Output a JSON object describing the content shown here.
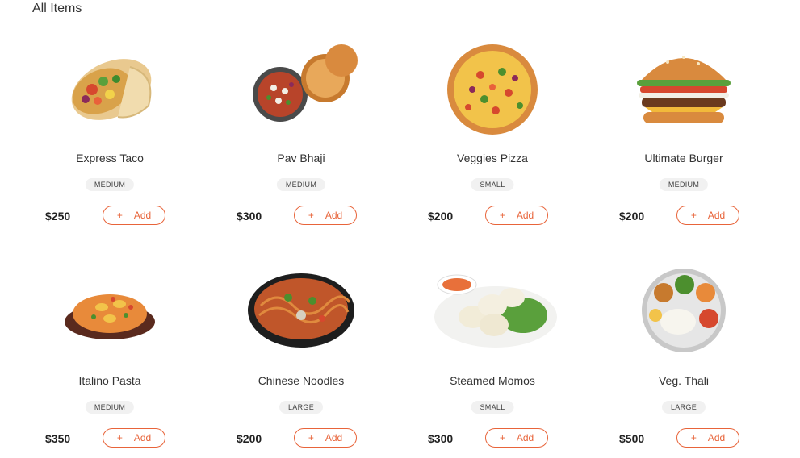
{
  "section_title": "All Items",
  "accent_color": "#e8643a",
  "items": [
    {
      "name": "Express Taco",
      "size": "MEDIUM",
      "price": "$250",
      "add_label": "Add",
      "add_icon": "+",
      "icon": "taco-image"
    },
    {
      "name": "Pav Bhaji",
      "size": "MEDIUM",
      "price": "$300",
      "add_label": "Add",
      "add_icon": "+",
      "icon": "pav-bhaji-image"
    },
    {
      "name": "Veggies Pizza",
      "size": "SMALL",
      "price": "$200",
      "add_label": "Add",
      "add_icon": "+",
      "icon": "pizza-image"
    },
    {
      "name": "Ultimate Burger",
      "size": "MEDIUM",
      "price": "$200",
      "add_label": "Add",
      "add_icon": "+",
      "icon": "burger-image"
    },
    {
      "name": "Italino Pasta",
      "size": "MEDIUM",
      "price": "$350",
      "add_label": "Add",
      "add_icon": "+",
      "icon": "pasta-image"
    },
    {
      "name": "Chinese Noodles",
      "size": "LARGE",
      "price": "$200",
      "add_label": "Add",
      "add_icon": "+",
      "icon": "noodles-image"
    },
    {
      "name": "Steamed Momos",
      "size": "SMALL",
      "price": "$300",
      "add_label": "Add",
      "add_icon": "+",
      "icon": "momos-image"
    },
    {
      "name": "Veg. Thali",
      "size": "LARGE",
      "price": "$500",
      "add_label": "Add",
      "add_icon": "+",
      "icon": "thali-image"
    }
  ]
}
